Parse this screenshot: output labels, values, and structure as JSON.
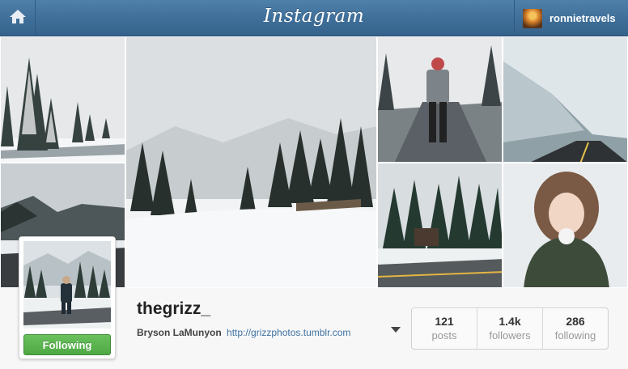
{
  "header": {
    "brand": "Instagram",
    "home_icon": "home-icon",
    "current_user": "ronnietravels"
  },
  "profile": {
    "username": "thegrizz_",
    "full_name": "Bryson LaMunyon",
    "website": "http://grizzphotos.tumblr.com",
    "follow_label": "Following",
    "stats": [
      {
        "value": "121",
        "label": "posts"
      },
      {
        "value": "1.4k",
        "label": "followers"
      },
      {
        "value": "286",
        "label": "following"
      }
    ]
  },
  "colors": {
    "header": "#3f6f99",
    "following_button": "#4ea844",
    "link": "#3f72a3"
  }
}
